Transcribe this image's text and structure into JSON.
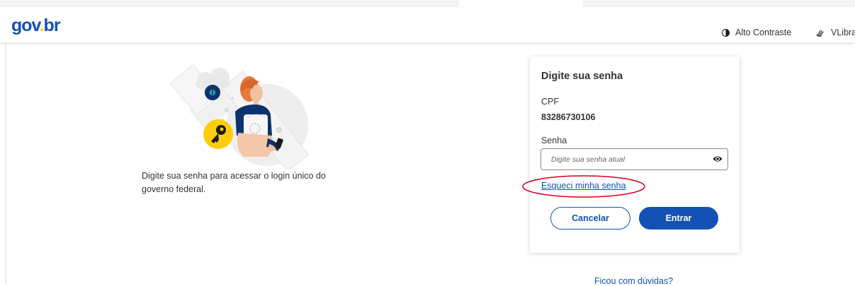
{
  "header": {
    "logo": {
      "gov": "gov",
      "dot": ".",
      "br": "br"
    },
    "contrast_label": "Alto Contraste",
    "vlibras_label": "VLibra"
  },
  "main": {
    "description": "Digite sua senha para acessar o login único do governo federal."
  },
  "card": {
    "title": "Digite sua senha",
    "cpf_label": "CPF",
    "cpf_value": "83286730106",
    "password_label": "Senha",
    "password_placeholder": "Digite sua senha atual",
    "password_value": "",
    "forgot_link": "Esqueci minha senha",
    "cancel_label": "Cancelar",
    "enter_label": "Entrar"
  },
  "footer": {
    "help_link": "Ficou com dúvidas?"
  },
  "colors": {
    "primary": "#1351b4",
    "logo_yellow": "#ffcd07",
    "annotation": "#d0021b"
  },
  "icons": {
    "contrast": "contrast-icon",
    "vlibras": "vlibras-hand-icon",
    "eye": "eye-icon"
  }
}
